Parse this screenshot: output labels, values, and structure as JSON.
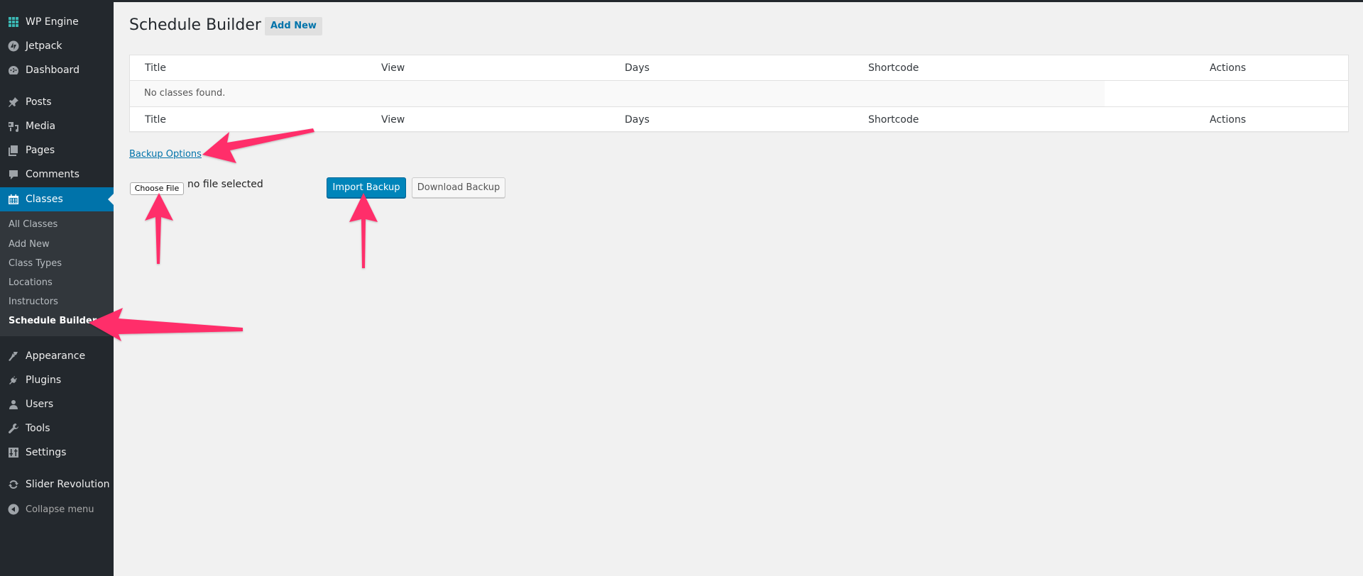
{
  "sidebar": {
    "items": [
      {
        "label": "WP Engine",
        "icon": "wp-engine-icon"
      },
      {
        "label": "Jetpack",
        "icon": "jetpack-icon"
      },
      {
        "label": "Dashboard",
        "icon": "dashboard-icon"
      },
      {
        "label": "Posts",
        "icon": "pin-icon"
      },
      {
        "label": "Media",
        "icon": "media-icon"
      },
      {
        "label": "Pages",
        "icon": "pages-icon"
      },
      {
        "label": "Comments",
        "icon": "comment-icon"
      },
      {
        "label": "Classes",
        "icon": "calendar-icon",
        "active": true
      },
      {
        "label": "Appearance",
        "icon": "paintbrush-icon"
      },
      {
        "label": "Plugins",
        "icon": "plugin-icon"
      },
      {
        "label": "Users",
        "icon": "user-icon"
      },
      {
        "label": "Tools",
        "icon": "wrench-icon"
      },
      {
        "label": "Settings",
        "icon": "settings-icon"
      },
      {
        "label": "Slider Revolution",
        "icon": "refresh-icon"
      }
    ],
    "submenu": [
      {
        "label": "All Classes"
      },
      {
        "label": "Add New"
      },
      {
        "label": "Class Types"
      },
      {
        "label": "Locations"
      },
      {
        "label": "Instructors"
      },
      {
        "label": "Schedule Builder",
        "current": true
      }
    ],
    "collapse_label": "Collapse menu"
  },
  "header": {
    "title": "Schedule Builder",
    "add_new_label": "Add New"
  },
  "table": {
    "columns": [
      "Title",
      "View",
      "Days",
      "Shortcode",
      "Actions"
    ],
    "empty_message": "No classes found."
  },
  "backup": {
    "link_label": "Backup Options",
    "choose_file_label": "Choose File",
    "file_status": "no file selected",
    "import_label": "Import Backup",
    "download_label": "Download Backup"
  },
  "colors": {
    "sidebar_bg": "#23282d",
    "submenu_bg": "#32373c",
    "accent": "#0073aa",
    "primary_button": "#0085ba",
    "annotation_arrow": "#ff2d6a"
  }
}
